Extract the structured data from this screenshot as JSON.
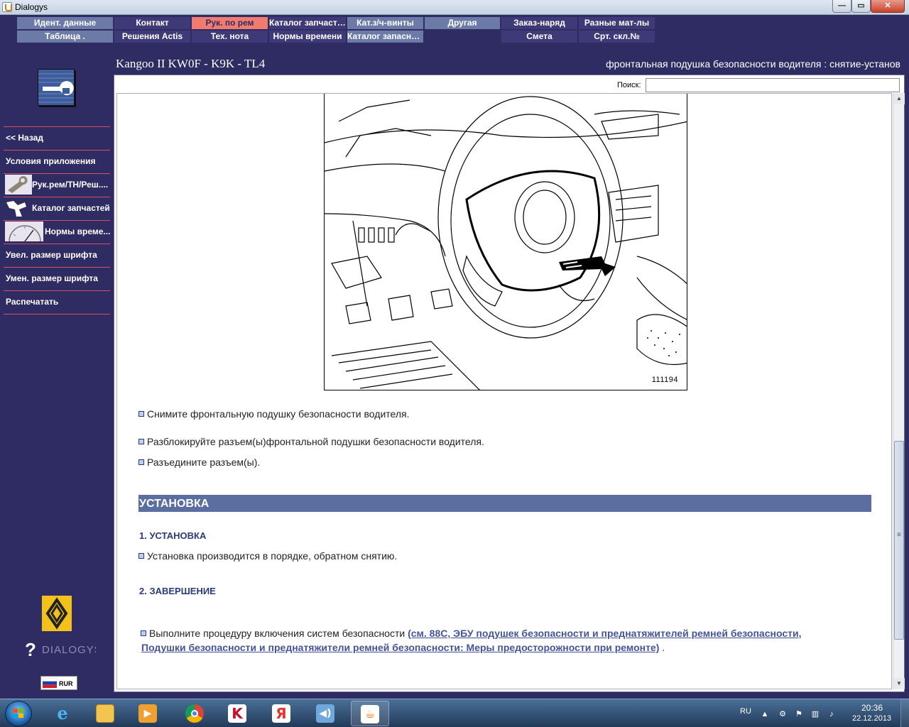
{
  "window": {
    "title": "Dialogys",
    "min_glyph": "—",
    "max_glyph": "▭",
    "close_glyph": "✕"
  },
  "topnav": {
    "row1": [
      "Идент. данные",
      "Контакт",
      "Рук. по рем",
      "Каталог запчастей",
      "Кат.з/ч-винты",
      "Другая",
      "Заказ-наряд",
      "Разные мат-лы"
    ],
    "row2": [
      "Таблица .",
      "Решения Actis",
      "Тех. нота",
      "Нормы времени",
      "Каталог запасны...",
      "Смета",
      "Срт. скл.№"
    ]
  },
  "header": {
    "vehicle": "Kangoo II KW0F - K9K - TL4",
    "operation": "фронтальная подушка безопасности водителя : снятие-установ"
  },
  "sidebar": {
    "tool_icon": "wrench-icon",
    "items": [
      {
        "label": "<< Назад"
      },
      {
        "label": "Условия приложения"
      },
      {
        "label": "Рук.рем/ТН/Реш....",
        "icon": "wrench-thumb-icon"
      },
      {
        "label": "Каталог запчастей",
        "icon": "parts-catalog-icon"
      },
      {
        "label": "Нормы време...",
        "icon": "time-gauge-icon"
      },
      {
        "label": "Увел. размер шрифта"
      },
      {
        "label": "Умен. размер шрифта"
      },
      {
        "label": "Распечатать"
      }
    ],
    "brand_logo": "renault-logo-icon",
    "brand_text": "DIALOGYS",
    "currency": "RUR"
  },
  "search": {
    "label": "Поиск:",
    "value": ""
  },
  "figure": {
    "number": "111194"
  },
  "steps": {
    "removal": [
      "Снимите фронтальную подушку безопасности водителя.",
      "Разблокируйте разъем(ы)фронтальной подушки безопасности водителя.",
      "Разъедините разъем(ы)."
    ],
    "install_section": "УСТАНОВКА",
    "sub1": "1. УСТАНОВКА",
    "sub1_text": "Установка производится в порядке, обратном снятию.",
    "sub2": "2. ЗАВЕРШЕНИЕ",
    "final_text": "Выполните процедуру включения систем безопасности ",
    "final_link_line1": "(см. 88С, ЭБУ подушек безопасности и преднатяжителей ремней безопасности,",
    "final_link_line2": "Подушки безопасности и преднатяжители ремней безопасности: Меры предосторожности при ремонте)",
    "final_tail": " ."
  },
  "taskbar": {
    "apps": [
      "explorer-icon",
      "internet-explorer-icon",
      "media-player-icon",
      "chrome-icon",
      "kaspersky-icon",
      "yandex-icon",
      "speaker-app-icon",
      "java-icon"
    ],
    "lang": "RU",
    "time": "20:36",
    "date": "22.12.2013",
    "tray_arrow": "▲"
  },
  "colors": {
    "background": "#2f2b63",
    "nav_active": "#f27b70",
    "nav_grey": "#6b7aa6",
    "banner": "#5a6fa0"
  }
}
